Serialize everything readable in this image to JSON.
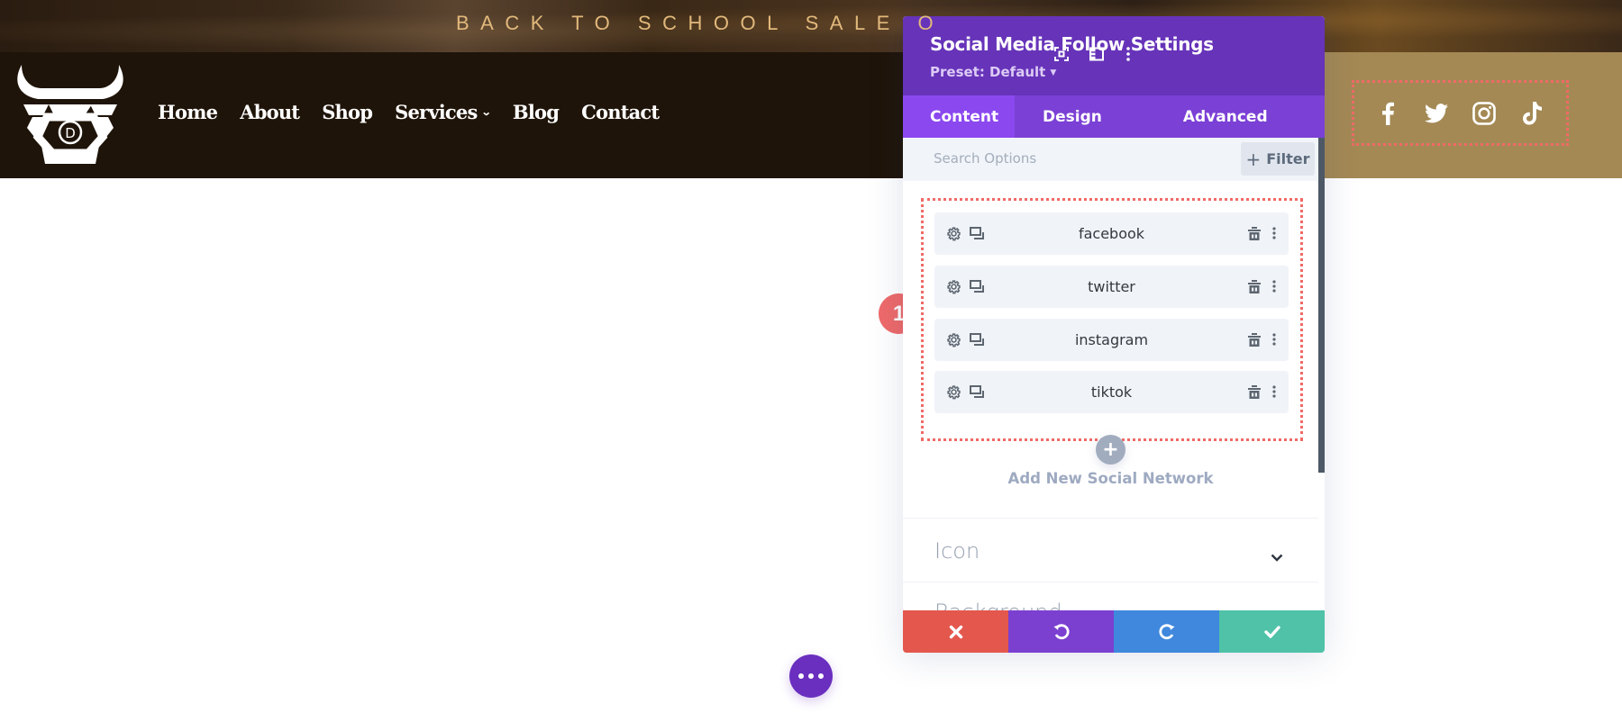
{
  "banner": {
    "text": "BACK TO SCHOOL SALE O"
  },
  "site": {
    "logo": {
      "letter": "D",
      "name": "bull-logo"
    },
    "nav": [
      {
        "label": "Home"
      },
      {
        "label": "About"
      },
      {
        "label": "Shop"
      },
      {
        "label": "Services",
        "has_dropdown": true
      },
      {
        "label": "Blog"
      },
      {
        "label": "Contact"
      }
    ],
    "social_icons": [
      "facebook-icon",
      "twitter-icon",
      "instagram-icon",
      "tiktok-icon"
    ],
    "colors": {
      "header_bg": "#1f1409",
      "header_right_bg": "#a48955",
      "banner_text": "#e2b97c"
    }
  },
  "annotation": {
    "badge_number": "1",
    "color": "#ef6a6a"
  },
  "panel": {
    "title": "Social Media Follow Settings",
    "preset_label": "Preset: Default",
    "header_icons": [
      "fullscreen-icon",
      "split-view-icon",
      "more-options-icon"
    ],
    "tabs": [
      {
        "label": "Content",
        "active": true
      },
      {
        "label": "Design",
        "active": false
      },
      {
        "label": "Advanced",
        "active": false
      }
    ],
    "search": {
      "placeholder": "Search Options",
      "value": ""
    },
    "filter_label": "Filter",
    "networks": [
      {
        "label": "facebook"
      },
      {
        "label": "twitter"
      },
      {
        "label": "instagram"
      },
      {
        "label": "tiktok"
      }
    ],
    "add_label": "Add New Social Network",
    "sections": [
      {
        "label": "Icon",
        "collapsed": true
      },
      {
        "label": "Background",
        "collapsed": true
      }
    ],
    "footer": {
      "discard": "discard",
      "undo": "undo",
      "redo": "redo",
      "save": "save"
    },
    "colors": {
      "header": "#6633b9",
      "tabs": "#7b40d5",
      "active_tab": "#8b48ef",
      "discard": "#e4574d",
      "undo": "#7b40d0",
      "redo": "#3f88dd",
      "save": "#4fc2a8"
    }
  },
  "fab": {
    "icon": "more-horizontal-icon"
  }
}
